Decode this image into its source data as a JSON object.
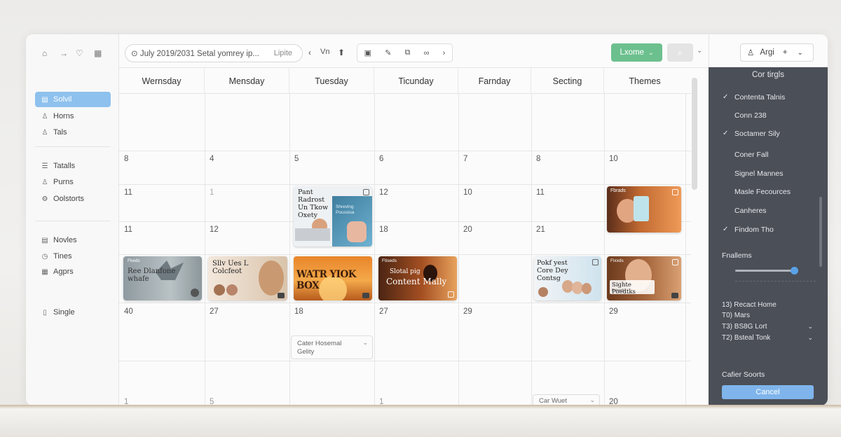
{
  "toolbar": {
    "search_text": "⊙ July 2019/2031 Setal yomrey ip...",
    "search_tag": "Lipite",
    "view_label": "Vn",
    "primary_button": "Lxome",
    "account_label": "Argi"
  },
  "sidebar": {
    "items": [
      {
        "label": "Solvil",
        "icon": "calendar-icon",
        "active": true
      },
      {
        "label": "Horns",
        "icon": "user-icon"
      },
      {
        "label": "Tals",
        "icon": "user-icon"
      },
      {
        "label": "Tatalls",
        "icon": "list-icon"
      },
      {
        "label": "Purns",
        "icon": "user-icon"
      },
      {
        "label": "Oolstorts",
        "icon": "settings-icon"
      },
      {
        "label": "Novles",
        "icon": "note-icon"
      },
      {
        "label": "Tines",
        "icon": "clock-icon"
      },
      {
        "label": "Agprs",
        "icon": "grid-icon"
      },
      {
        "label": "Single",
        "icon": "doc-icon"
      }
    ]
  },
  "calendar": {
    "days": [
      "Wernsday",
      "Mensday",
      "Tuesday",
      "Ticunday",
      "Farnday",
      "Secting",
      "Themes"
    ],
    "day_numbers": {
      "row2": [
        "8",
        "4",
        "5",
        "6",
        "7",
        "8",
        "10"
      ],
      "row3": [
        "11",
        "1",
        "",
        "12",
        "10",
        "11",
        ""
      ],
      "row4": [
        "11",
        "12",
        "",
        "18",
        "20",
        "21",
        ""
      ],
      "row6": [
        "40",
        "27",
        "18",
        "27",
        "29",
        "",
        "29"
      ],
      "row8": [
        "1",
        "5",
        "",
        "1",
        "",
        "",
        "20"
      ]
    },
    "events": [
      {
        "title": "Pant Radrost Un Tkow Oxety",
        "subtitle": "Shrevlng Poussisa"
      },
      {
        "title": "Fbrads"
      },
      {
        "title": "Fkeds",
        "subtitle": "Ree Dlanfone whafe"
      },
      {
        "title": "Sllv Ues L Colcfeot"
      },
      {
        "title": "WATR YIOK BOX"
      },
      {
        "title": "Content Mally",
        "subtitle": "Slotal pig"
      },
      {
        "title": "Pokf yest Core Dey Contsg"
      },
      {
        "title": "Sighte Poedtks",
        "subtitle": "Prioeds"
      }
    ],
    "mini_cards": [
      {
        "line1": "Cater Hosemal",
        "line2": "Gelity"
      },
      {
        "line1": "Car Wuet",
        "line2": ""
      }
    ]
  },
  "panel": {
    "title": "Cor tirgls",
    "items": [
      {
        "label": "Contenta Talnis",
        "checked": true
      },
      {
        "label": "Conn 238",
        "checked": false
      },
      {
        "label": "Soctamer Sily",
        "checked": true
      },
      {
        "label": "Coner Fall",
        "checked": false
      },
      {
        "label": "Signel Mannes",
        "checked": false
      },
      {
        "label": "Masle Fecources",
        "checked": false
      },
      {
        "label": "Canheres",
        "checked": false
      },
      {
        "label": "Findom Tho",
        "checked": true
      }
    ],
    "filter_label": "Fnallems",
    "slider_value": 0.95,
    "rows": [
      {
        "label": "13) Recact Home",
        "dropdown": false
      },
      {
        "label": "T0) Mars",
        "dropdown": false
      },
      {
        "label": "T3) BS8G Lort",
        "dropdown": true
      },
      {
        "label": "T2) Bsteal Tonk",
        "dropdown": true
      }
    ],
    "footer_label": "Cafier Soorts",
    "cancel_button": "Cancel"
  },
  "colors": {
    "accent_green": "#6cc08e",
    "accent_blue": "#8ec1ee",
    "panel_dark": "#4b4f57"
  }
}
